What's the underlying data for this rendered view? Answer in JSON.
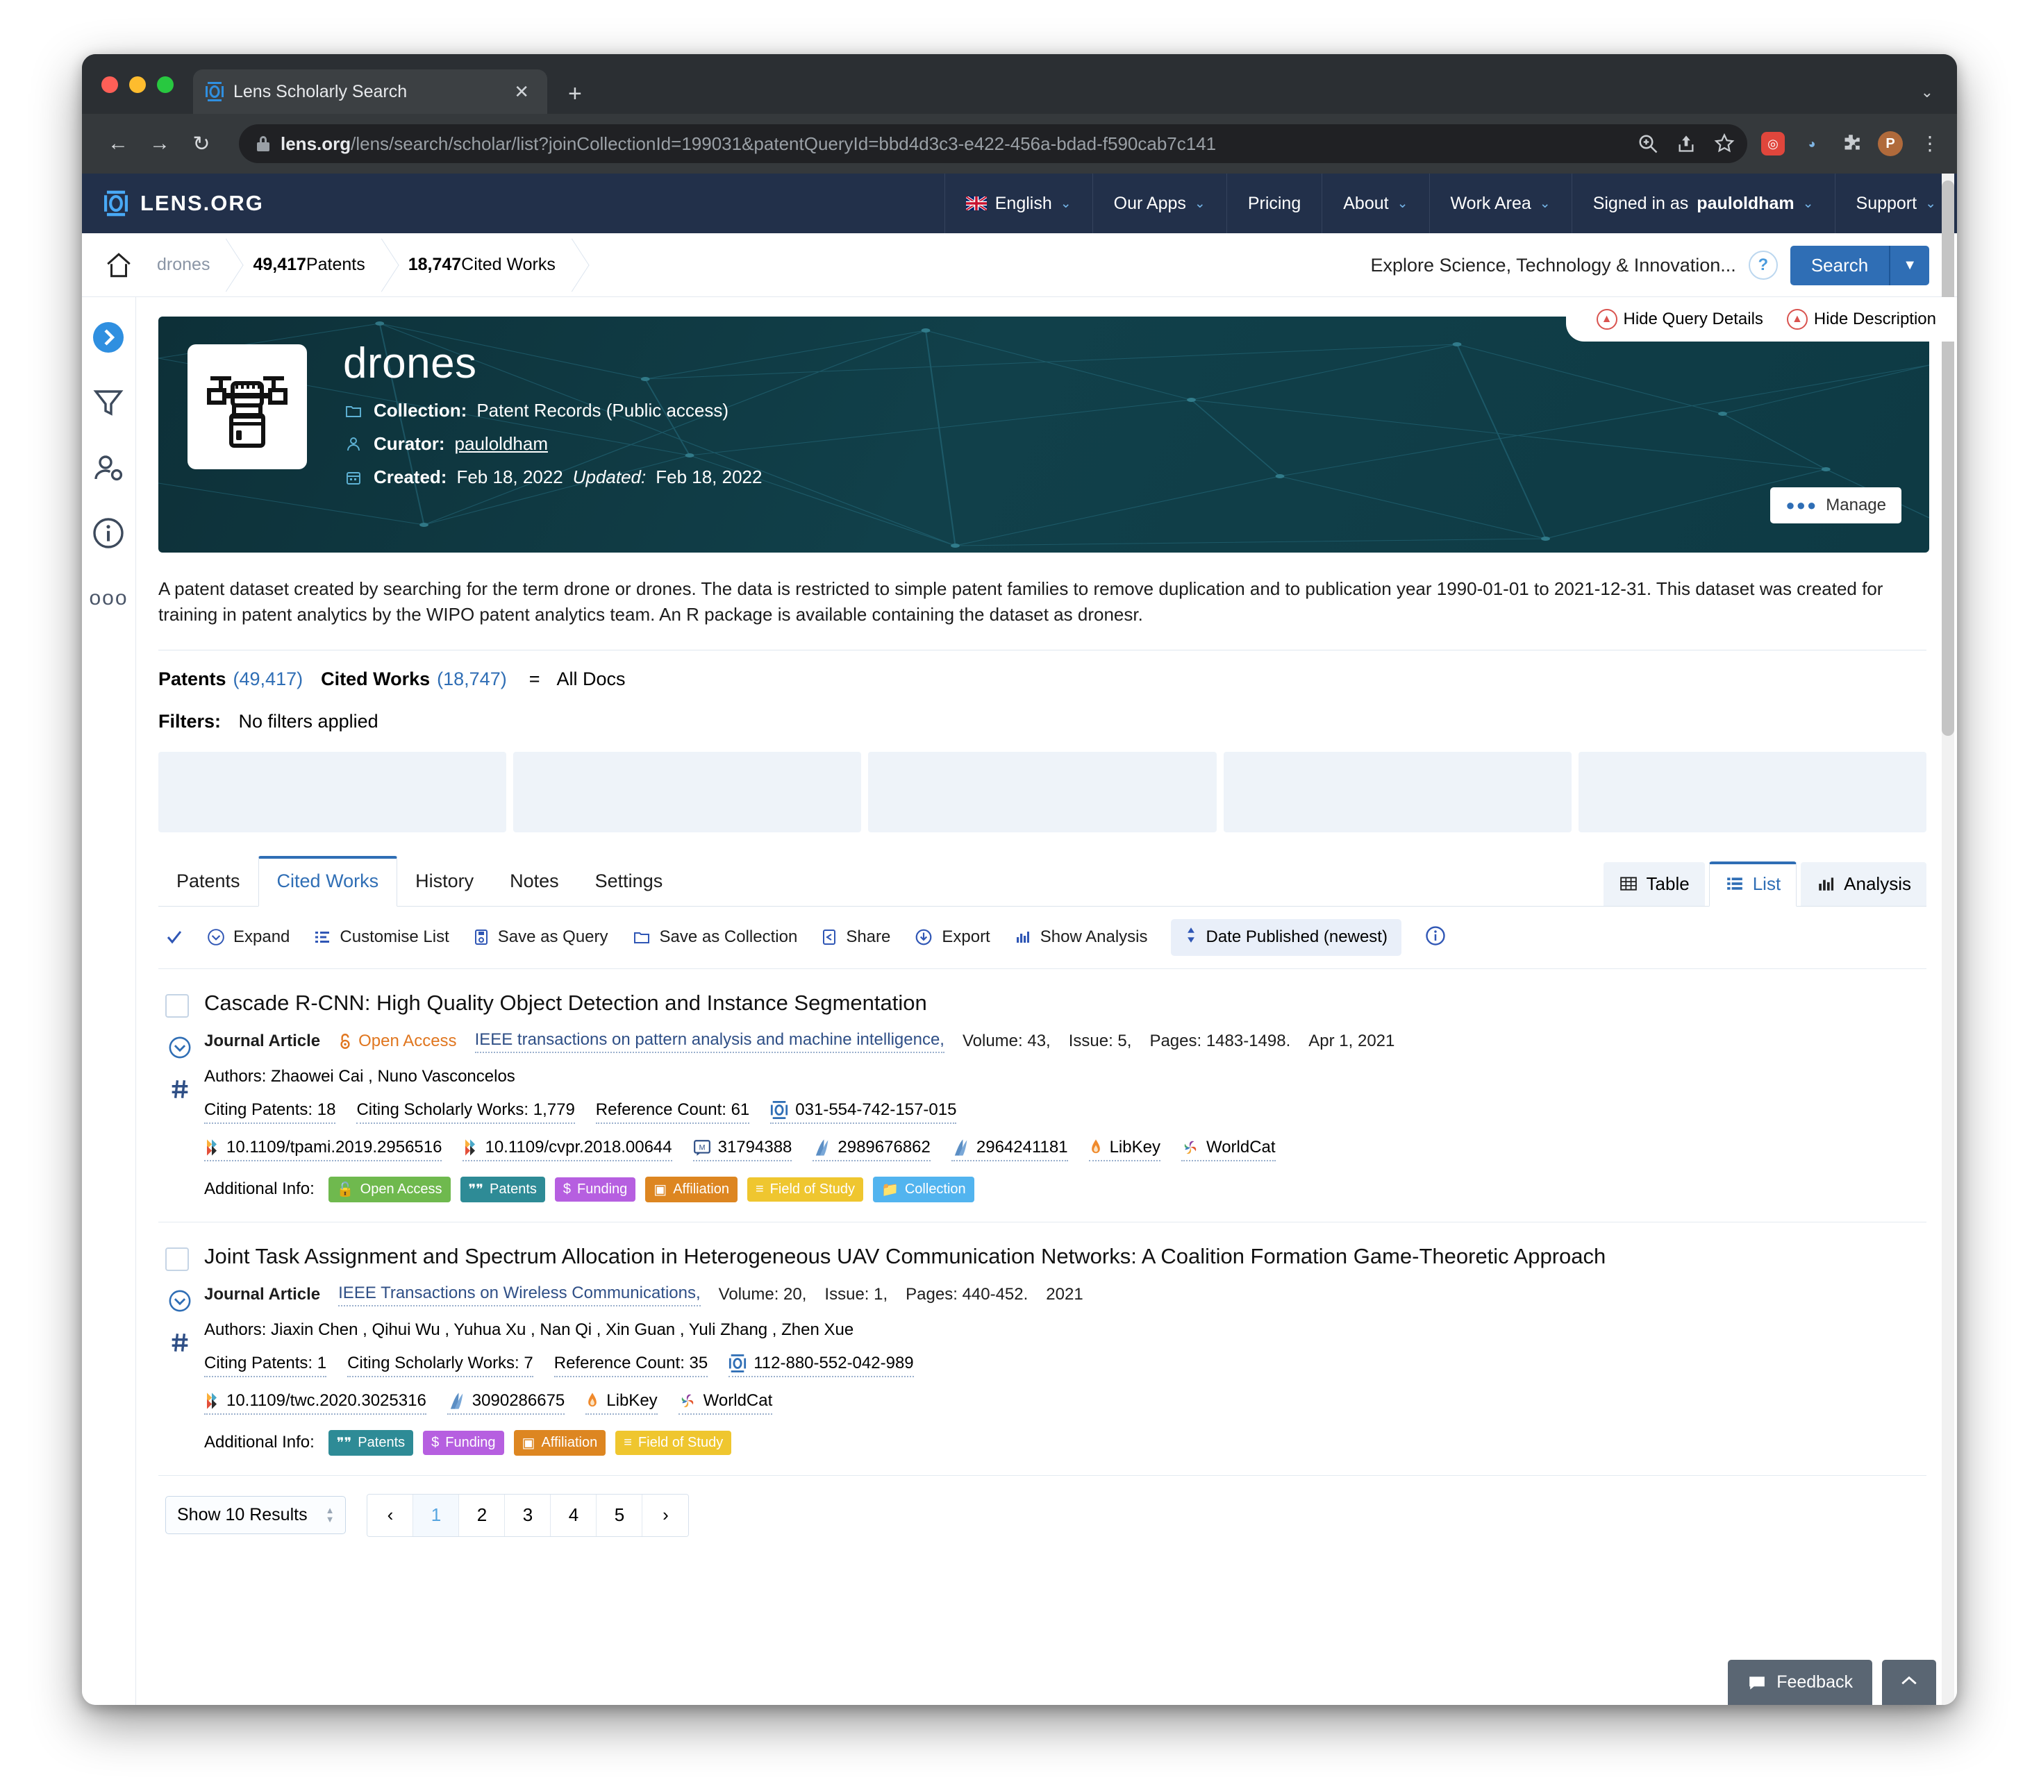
{
  "browser": {
    "tab_title": "Lens Scholarly Search",
    "tab_favicon": "lens-logo-icon",
    "new_tab_label": "+",
    "close_label": "✕",
    "url_domain": "lens.org",
    "url_path": "/lens/search/scholar/list?joinCollectionId=199031&patentQueryId=bbd4d3c3-e422-456a-bdad-f590cab7c141",
    "back_label": "←",
    "forward_label": "→",
    "reload_label": "↻",
    "profile_initial": "P",
    "menu_label": "⋮",
    "window_chevron": "⌄"
  },
  "topnav": {
    "brand": "LENS.ORG",
    "items": [
      {
        "label": "English",
        "caret": "⌄",
        "icon": "uk-flag-icon"
      },
      {
        "label": "Our Apps",
        "caret": "⌄"
      },
      {
        "label": "Pricing",
        "caret": ""
      },
      {
        "label": "About",
        "caret": "⌄"
      },
      {
        "label": "Work Area",
        "caret": "⌄"
      },
      {
        "label": "Signed in as ",
        "bold": "pauloldham",
        "caret": "⌄"
      },
      {
        "label": "Support",
        "caret": "⌄"
      }
    ]
  },
  "breadcrumb": {
    "home_icon": "home-icon",
    "items": [
      {
        "text": "drones",
        "muted": true
      },
      {
        "bold": "49,417",
        "text": " Patents"
      },
      {
        "bold": "18,747",
        "text": " Cited Works"
      }
    ]
  },
  "search": {
    "placeholder": "Explore Science, Technology & Innovation...",
    "help_label": "?",
    "button_label": "Search",
    "dropdown_caret": "▼"
  },
  "query_toggles": [
    {
      "label": "Hide Query Details"
    },
    {
      "label": "Hide Description"
    }
  ],
  "hero": {
    "title": "drones",
    "thumb_icon": "drone-icon",
    "meta": [
      {
        "icon": "folder-icon",
        "label": "Collection:",
        "value": "Patent Records (Public access)"
      },
      {
        "icon": "user-icon",
        "label": "Curator:",
        "value": "pauloldham",
        "link": true
      },
      {
        "icon": "calendar-icon",
        "label": "Created:",
        "value": "Feb 18, 2022",
        "label2": "Updated:",
        "value2": "Feb 18, 2022"
      }
    ],
    "manage_label": "Manage"
  },
  "description": "A patent dataset created by searching for the term drone or drones. The data is restricted to simple patent families to remove duplication and to publication year 1990-01-01 to 2021-12-31. This dataset was created for training in patent analytics by the WIPO patent analytics team. An R package is available containing the dataset as dronesr.",
  "counts": {
    "patents_label": "Patents",
    "patents_value": "(49,417)",
    "cited_label": "Cited Works",
    "cited_value": "(18,747)",
    "equals": "=",
    "all_docs": "All Docs"
  },
  "filters": {
    "label": "Filters:",
    "value": "No filters applied"
  },
  "tabs": [
    {
      "label": "Patents",
      "active": false
    },
    {
      "label": "Cited Works",
      "active": true
    },
    {
      "label": "History",
      "active": false
    },
    {
      "label": "Notes",
      "active": false
    },
    {
      "label": "Settings",
      "active": false
    }
  ],
  "views": [
    {
      "label": "Table",
      "icon": "table-icon",
      "active": false
    },
    {
      "label": "List",
      "icon": "list-icon",
      "active": true
    },
    {
      "label": "Analysis",
      "icon": "bar-chart-icon",
      "active": false
    }
  ],
  "toolbar": {
    "select_all_icon": "check-icon",
    "items": [
      {
        "label": "Expand",
        "icon": "chevron-circle-down-icon"
      },
      {
        "label": "Customise List",
        "icon": "list-settings-icon"
      },
      {
        "label": "Save as Query",
        "icon": "save-icon"
      },
      {
        "label": "Save as Collection",
        "icon": "folder-icon"
      },
      {
        "label": "Share",
        "icon": "share-icon"
      },
      {
        "label": "Export",
        "icon": "download-cloud-icon"
      },
      {
        "label": "Show Analysis",
        "icon": "bar-chart-icon"
      }
    ],
    "sort_label": "Date Published (newest)",
    "sort_icon": "sort-updown-icon",
    "info_icon": "info-icon"
  },
  "results": [
    {
      "title": "Cascade R-CNN: High Quality Object Detection and Instance Segmentation",
      "type": "Journal Article",
      "open_access": "Open Access",
      "source": "IEEE transactions on pattern analysis and machine intelligence,",
      "volume": "Volume: 43,",
      "issue": "Issue: 5,",
      "pages": "Pages: 1483-1498.",
      "date": "Apr 1, 2021",
      "authors_label": "Authors:",
      "authors": "Zhaowei Cai , Nuno Vasconcelos",
      "metrics": [
        {
          "label": "Citing Patents: 18"
        },
        {
          "label": "Citing Scholarly Works: 1,779"
        },
        {
          "label": "Reference Count: 61"
        },
        {
          "label": "031-554-742-157-015",
          "icon": "lens-id-icon"
        }
      ],
      "identifiers": [
        {
          "label": "10.1109/tpami.2019.2956516",
          "icon": "crossref-icon"
        },
        {
          "label": "10.1109/cvpr.2018.00644",
          "icon": "crossref-icon"
        },
        {
          "label": "31794388",
          "icon": "pubmed-icon"
        },
        {
          "label": "2989676862",
          "icon": "msa-icon"
        },
        {
          "label": "2964241181",
          "icon": "msa-icon"
        },
        {
          "label": "LibKey",
          "icon": "libkey-icon"
        },
        {
          "label": "WorldCat",
          "icon": "worldcat-icon"
        }
      ],
      "additional_label": "Additional Info:",
      "chips": [
        {
          "label": "Open Access",
          "color": "#6fb94e",
          "icon": "unlock-icon"
        },
        {
          "label": "Patents",
          "color": "#2e8b96",
          "icon": "patents-icon"
        },
        {
          "label": "Funding",
          "color": "#b65fe0",
          "icon": "dollar-icon"
        },
        {
          "label": "Affiliation",
          "color": "#dd8621",
          "icon": "building-icon"
        },
        {
          "label": "Field of Study",
          "color": "#efc62f",
          "icon": "list-icon"
        },
        {
          "label": "Collection",
          "color": "#52b4ef",
          "icon": "folder-icon"
        }
      ]
    },
    {
      "title": "Joint Task Assignment and Spectrum Allocation in Heterogeneous UAV Communication Networks: A Coalition Formation Game-Theoretic Approach",
      "type": "Journal Article",
      "open_access": "",
      "source": "IEEE Transactions on Wireless Communications,",
      "volume": "Volume: 20,",
      "issue": "Issue: 1,",
      "pages": "Pages: 440-452.",
      "date": "2021",
      "authors_label": "Authors:",
      "authors": "Jiaxin Chen , Qihui Wu , Yuhua Xu , Nan Qi , Xin Guan , Yuli Zhang , Zhen Xue",
      "metrics": [
        {
          "label": "Citing Patents: 1"
        },
        {
          "label": "Citing Scholarly Works: 7"
        },
        {
          "label": "Reference Count: 35"
        },
        {
          "label": "112-880-552-042-989",
          "icon": "lens-id-icon"
        }
      ],
      "identifiers": [
        {
          "label": "10.1109/twc.2020.3025316",
          "icon": "crossref-icon"
        },
        {
          "label": "3090286675",
          "icon": "msa-icon"
        },
        {
          "label": "LibKey",
          "icon": "libkey-icon"
        },
        {
          "label": "WorldCat",
          "icon": "worldcat-icon"
        }
      ],
      "additional_label": "Additional Info:",
      "chips": [
        {
          "label": "Patents",
          "color": "#2e8b96",
          "icon": "patents-icon"
        },
        {
          "label": "Funding",
          "color": "#b65fe0",
          "icon": "dollar-icon"
        },
        {
          "label": "Affiliation",
          "color": "#dd8621",
          "icon": "building-icon"
        },
        {
          "label": "Field of Study",
          "color": "#efc62f",
          "icon": "list-icon"
        }
      ]
    }
  ],
  "pagination": {
    "show_label": "Show 10 Results",
    "prev": "‹",
    "next": "›",
    "pages": [
      "1",
      "2",
      "3",
      "4",
      "5"
    ],
    "current": "1"
  },
  "footer": {
    "feedback_label": "Feedback",
    "feedback_icon": "comment-icon",
    "to_top_icon": "chevron-up-icon",
    "to_top_label": "⌃"
  }
}
